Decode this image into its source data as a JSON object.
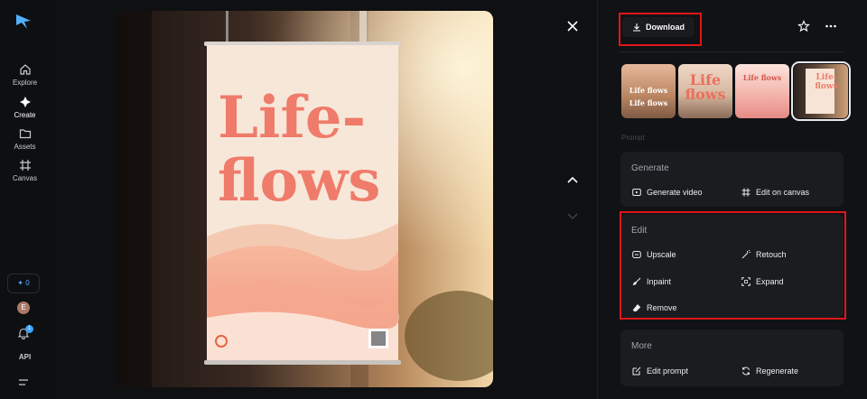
{
  "nav": {
    "items": [
      {
        "label": "Explore",
        "icon": "home-icon"
      },
      {
        "label": "Create",
        "icon": "sparkle-icon"
      },
      {
        "label": "Assets",
        "icon": "folder-icon"
      },
      {
        "label": "Canvas",
        "icon": "canvas-icon"
      }
    ],
    "credits": "0",
    "avatar_initial": "E",
    "notifications": "1",
    "api_label": "API"
  },
  "image": {
    "poster_title_line1": "Life-",
    "poster_title_line2": "flows"
  },
  "toolbar": {
    "download_label": "Download"
  },
  "thumbnails": [
    {
      "text_line1": "Life flows",
      "text_line2": "Life flows",
      "selected": false
    },
    {
      "text_line1": "Life",
      "text_line2": "flows",
      "selected": false
    },
    {
      "text_line1": "Life flows",
      "text_line2": "",
      "selected": false
    },
    {
      "text_line1": "Life-",
      "text_line2": "flows",
      "selected": true
    }
  ],
  "prompt_label": "Prompt",
  "generate": {
    "title": "Generate",
    "actions": [
      {
        "label": "Generate video",
        "icon": "video-icon"
      },
      {
        "label": "Edit on canvas",
        "icon": "canvas-icon"
      }
    ]
  },
  "edit": {
    "title": "Edit",
    "actions": [
      {
        "label": "Upscale",
        "icon": "upscale-icon"
      },
      {
        "label": "Retouch",
        "icon": "magic-wand-icon"
      },
      {
        "label": "Inpaint",
        "icon": "brush-icon"
      },
      {
        "label": "Expand",
        "icon": "expand-icon"
      },
      {
        "label": "Remove",
        "icon": "eraser-icon"
      }
    ]
  },
  "more": {
    "title": "More",
    "actions": [
      {
        "label": "Edit prompt",
        "icon": "edit-icon"
      },
      {
        "label": "Regenerate",
        "icon": "refresh-icon"
      }
    ]
  },
  "colors": {
    "accent_blue": "#3da1ff",
    "highlight_red": "#e01616",
    "poster_text": "#ef7b6a"
  }
}
